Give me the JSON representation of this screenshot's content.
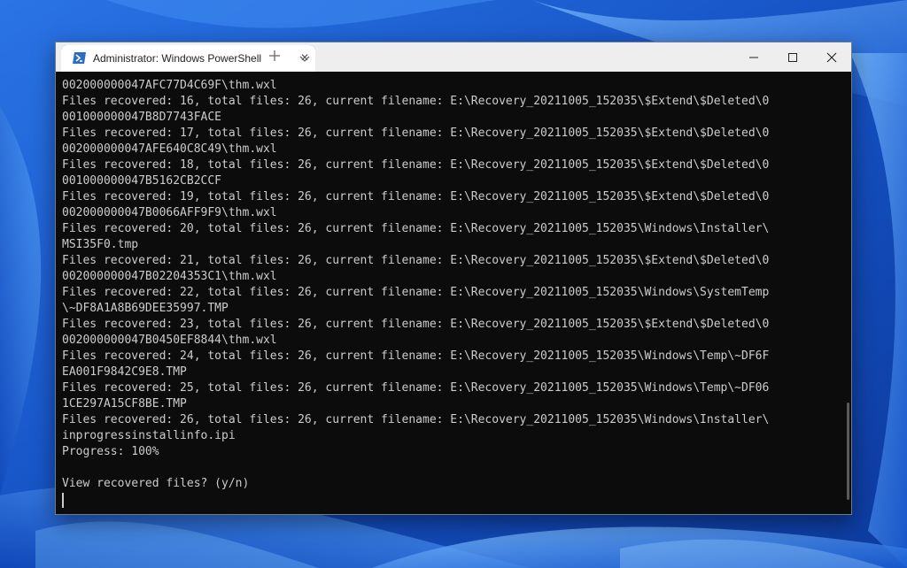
{
  "window": {
    "tab_title": "Administrator: Windows PowerShell",
    "tab_icon": "powershell-icon",
    "controls": [
      "minimize-icon",
      "maximize-icon",
      "close-icon"
    ]
  },
  "terminal": {
    "lines": [
      "002000000047AFC77D4C69F\\thm.wxl",
      "Files recovered: 16, total files: 26, current filename: E:\\Recovery_20211005_152035\\$Extend\\$Deleted\\0",
      "001000000047B8D7743FACE",
      "Files recovered: 17, total files: 26, current filename: E:\\Recovery_20211005_152035\\$Extend\\$Deleted\\0",
      "002000000047AFE640C8C49\\thm.wxl",
      "Files recovered: 18, total files: 26, current filename: E:\\Recovery_20211005_152035\\$Extend\\$Deleted\\0",
      "001000000047B5162CB2CCF",
      "Files recovered: 19, total files: 26, current filename: E:\\Recovery_20211005_152035\\$Extend\\$Deleted\\0",
      "002000000047B0066AFF9F9\\thm.wxl",
      "Files recovered: 20, total files: 26, current filename: E:\\Recovery_20211005_152035\\Windows\\Installer\\",
      "MSI35F0.tmp",
      "Files recovered: 21, total files: 26, current filename: E:\\Recovery_20211005_152035\\$Extend\\$Deleted\\0",
      "002000000047B02204353C1\\thm.wxl",
      "Files recovered: 22, total files: 26, current filename: E:\\Recovery_20211005_152035\\Windows\\SystemTemp",
      "\\~DF8A1A8B69DEE35997.TMP",
      "Files recovered: 23, total files: 26, current filename: E:\\Recovery_20211005_152035\\$Extend\\$Deleted\\0",
      "002000000047B0450EF8844\\thm.wxl",
      "Files recovered: 24, total files: 26, current filename: E:\\Recovery_20211005_152035\\Windows\\Temp\\~DF6F",
      "EA001F9842C9E8.TMP",
      "Files recovered: 25, total files: 26, current filename: E:\\Recovery_20211005_152035\\Windows\\Temp\\~DF06",
      "1CE297A15CF8BE.TMP",
      "Files recovered: 26, total files: 26, current filename: E:\\Recovery_20211005_152035\\Windows\\Installer\\",
      "inprogressinstallinfo.ipi",
      "Progress: 100%",
      "",
      "View recovered files? (y/n)"
    ]
  },
  "colors": {
    "terminal_bg": "#0c0c0c",
    "terminal_fg": "#cccccc",
    "titlebar_bg": "#eeeeee",
    "wallpaper": "#1b5fd0"
  }
}
